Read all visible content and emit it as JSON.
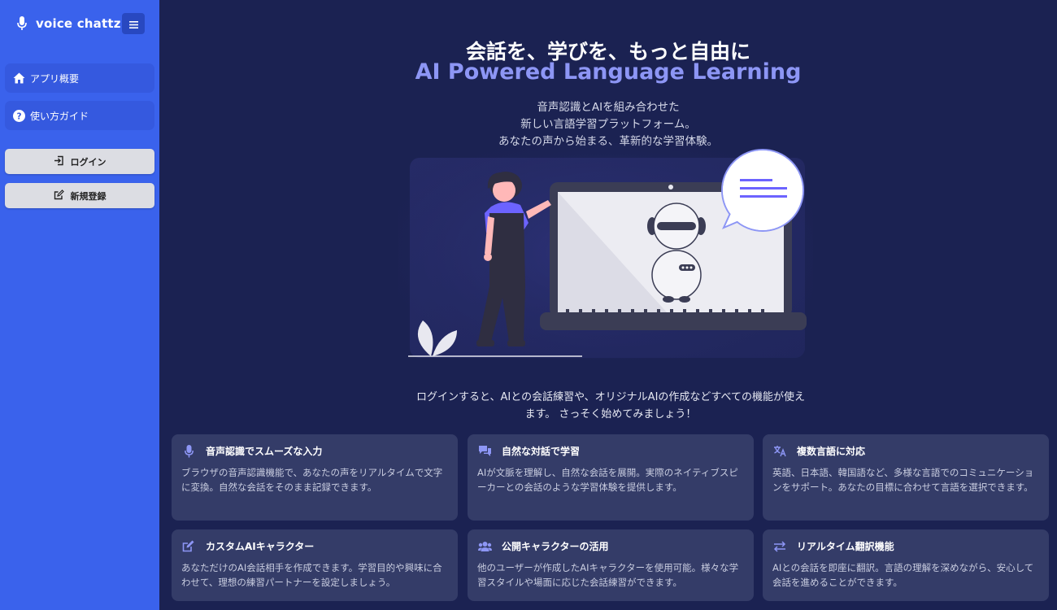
{
  "app": {
    "name": "voice chattz"
  },
  "sidebar": {
    "nav": [
      {
        "label": "アプリ概要",
        "icon": "home-icon"
      },
      {
        "label": "使い方ガイド",
        "icon": "question-circle-icon"
      }
    ],
    "auth": [
      {
        "label": "ログイン",
        "icon": "login-icon"
      },
      {
        "label": "新規登録",
        "icon": "edit-square-icon"
      }
    ]
  },
  "hero": {
    "title": "会話を、学びを、もっと自由に",
    "subtitle": "AI Powered Language Learning",
    "description": [
      "音声認識とAIを組み合わせた",
      "新しい言語学習プラットフォーム。",
      "あなたの声から始まる、革新的な学習体験。"
    ]
  },
  "login_note": {
    "line1": "ログインすると、AIとの会話練習や、オリジナルAIの作成などすべての機能が使え",
    "line2": "ます。 さっそく始めてみましょう！"
  },
  "features": [
    {
      "title": "音声認識でスムーズな入力",
      "icon": "microphone-icon",
      "description": "ブラウザの音声認識機能で、あなたの声をリアルタイムで文字に変換。自然な会話をそのまま記録できます。"
    },
    {
      "title": "自然な対話で学習",
      "icon": "chat-bubbles-icon",
      "description": "AIが文脈を理解し、自然な会話を展開。実際のネイティブスピーカーとの会話のような学習体験を提供します。"
    },
    {
      "title": "複数言語に対応",
      "icon": "translate-icon",
      "description": "英語、日本語、韓国語など、多様な言語でのコミュニケーションをサポート。あなたの目標に合わせて言語を選択できます。"
    },
    {
      "title": "カスタムAIキャラクター",
      "icon": "pencil-square-icon",
      "description": "あなただけのAI会話相手を作成できます。学習目的や興味に合わせて、理想の練習パートナーを設定しましょう。"
    },
    {
      "title": "公開キャラクターの活用",
      "icon": "users-icon",
      "description": "他のユーザーが作成したAIキャラクターを使用可能。様々な学習スタイルや場面に応じた会話練習ができます。"
    },
    {
      "title": "リアルタイム翻訳機能",
      "icon": "swap-arrows-icon",
      "description": "AIとの会話を即座に翻訳。言語の理解を深めながら、安心して会話を進めることができます。"
    }
  ],
  "colors": {
    "sidebar": "#3a62ec",
    "main_bg": "#1b2252",
    "card_bg": "#343c68",
    "accent": "#8d96f5"
  }
}
